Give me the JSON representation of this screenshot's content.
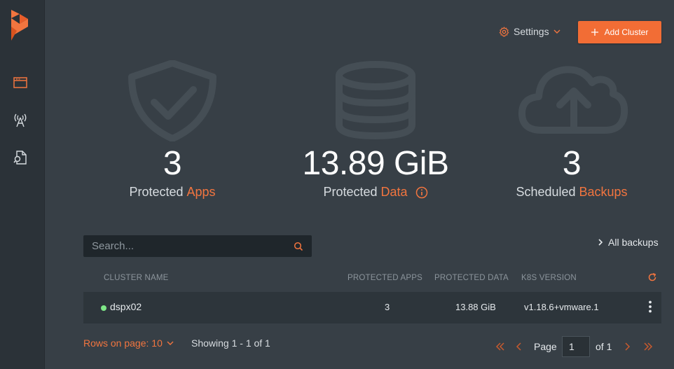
{
  "header": {
    "settings_label": "Settings",
    "add_cluster_label": "Add Cluster"
  },
  "sidebar": {
    "items": [
      {
        "icon": "browser-window-icon",
        "active": true
      },
      {
        "icon": "antenna-icon",
        "active": false
      },
      {
        "icon": "document-search-icon",
        "active": false
      }
    ]
  },
  "stats": {
    "apps": {
      "value": "3",
      "label_prefix": "Protected",
      "label_accent": "Apps",
      "icon": "shield-check-icon"
    },
    "data": {
      "value": "13.89 GiB",
      "label_prefix": "Protected",
      "label_accent": "Data",
      "icon": "database-icon"
    },
    "backups": {
      "value": "3",
      "label_prefix": "Scheduled",
      "label_accent": "Backups",
      "icon": "cloud-upload-icon"
    }
  },
  "search": {
    "placeholder": "Search..."
  },
  "all_backups_label": "All backups",
  "table": {
    "columns": [
      "CLUSTER NAME",
      "PROTECTED APPS",
      "PROTECTED DATA",
      "K8S VERSION"
    ],
    "rows": [
      {
        "name": "dspx02",
        "status": "online",
        "protected_apps": "3",
        "protected_data": "13.88 GiB",
        "k8s_version": "v1.18.6+vmware.1"
      }
    ]
  },
  "pagination": {
    "rows_label": "Rows on page: 10",
    "showing": "Showing 1 - 1 of 1",
    "page_label": "Page",
    "page_value": "1",
    "of_label": "of 1"
  },
  "colors": {
    "accent": "#f2753f",
    "button": "#f26d35",
    "background": "#373f46",
    "sidebar": "#2b3238",
    "status_online": "#7ee787"
  }
}
